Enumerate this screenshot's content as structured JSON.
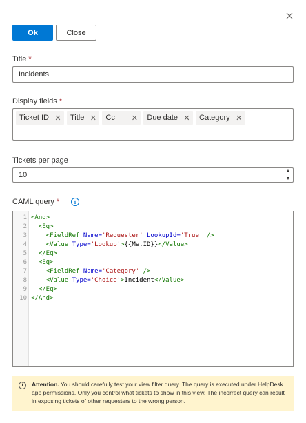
{
  "dialog": {
    "ok_label": "Ok",
    "close_label": "Close"
  },
  "title_field": {
    "label": "Title",
    "required": "*",
    "value": "Incidents"
  },
  "display_fields": {
    "label": "Display fields",
    "required": "*",
    "chips": [
      "Ticket ID",
      "Title",
      "Cc",
      "Due date",
      "Category"
    ]
  },
  "tickets_per_page": {
    "label": "Tickets per page",
    "value": "10"
  },
  "caml_query": {
    "label": "CAML query",
    "required": "*",
    "lines": [
      {
        "num": "1"
      },
      {
        "num": "2"
      },
      {
        "num": "3"
      },
      {
        "num": "4"
      },
      {
        "num": "5"
      },
      {
        "num": "6"
      },
      {
        "num": "7"
      },
      {
        "num": "8"
      },
      {
        "num": "9"
      },
      {
        "num": "10"
      }
    ],
    "tokens": {
      "and_open": "<And>",
      "eq_open": "<Eq>",
      "fieldref_open": "<FieldRef",
      "name_attr": "Name=",
      "requester": "'Requester'",
      "lookupid_attr": "LookupId=",
      "true_val": "'True'",
      "self_close": "/>",
      "value_open": "<Value",
      "type_attr": "Type=",
      "lookup_val": "'Lookup'",
      "gt": ">",
      "me_id": "{{Me.ID}}",
      "value_close": "</Value>",
      "eq_close": "</Eq>",
      "category_val": "'Category'",
      "choice_val": "'Choice'",
      "incident": "Incident",
      "and_close": "</And>"
    }
  },
  "warning": {
    "title": "Attention.",
    "text": "You should carefully test your view filter query. The query is executed under HelpDesk app permissions. Only you control what tickets to show in this view. The incorrect query can result in exposing tickets of other requesters to the wrong person."
  }
}
